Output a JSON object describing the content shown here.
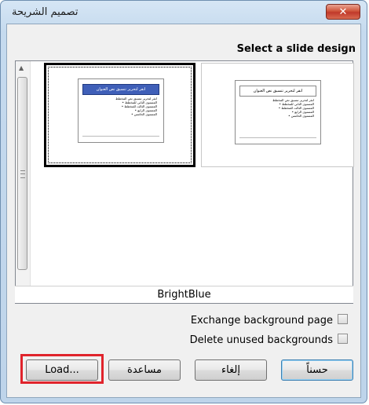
{
  "window": {
    "title": "تصميم الشريحة",
    "close_symbol": "✕"
  },
  "main": {
    "heading": "Select a slide design",
    "designs": [
      {
        "name": "BrightBlue",
        "slide_title": "انقر لتحرير تنسيق نص العنوان",
        "slide_lines": [
          "انقر لتحرير تنسيق نص المخطط",
          "• المستوى الثاني للمخطط",
          "• المستوى الثالث للمخطط",
          "• المستوى الرابع",
          "• المستوى الخامس"
        ]
      },
      {
        "name": "",
        "slide_title": "انقر لتحرير تنسيق نص العنوان",
        "slide_lines": [
          "انقر لتحرير تنسيق نص المخطط",
          "• المستوى الثاني للمخطط",
          "• المستوى الثالث للمخطط",
          "• المستوى الرابع",
          "• المستوى الخامس"
        ]
      }
    ],
    "selected_caption": "BrightBlue"
  },
  "options": {
    "exchange_background": "Exchange background page",
    "delete_unused": "Delete unused backgrounds"
  },
  "buttons": {
    "load": "Load...",
    "help": "مساعدة",
    "cancel": "إلغاء",
    "ok": "حسناً"
  },
  "colors": {
    "highlight_frame": "#e0242c",
    "close_button": "#c0392b",
    "slide_title_fill": "#3f5fb8"
  }
}
